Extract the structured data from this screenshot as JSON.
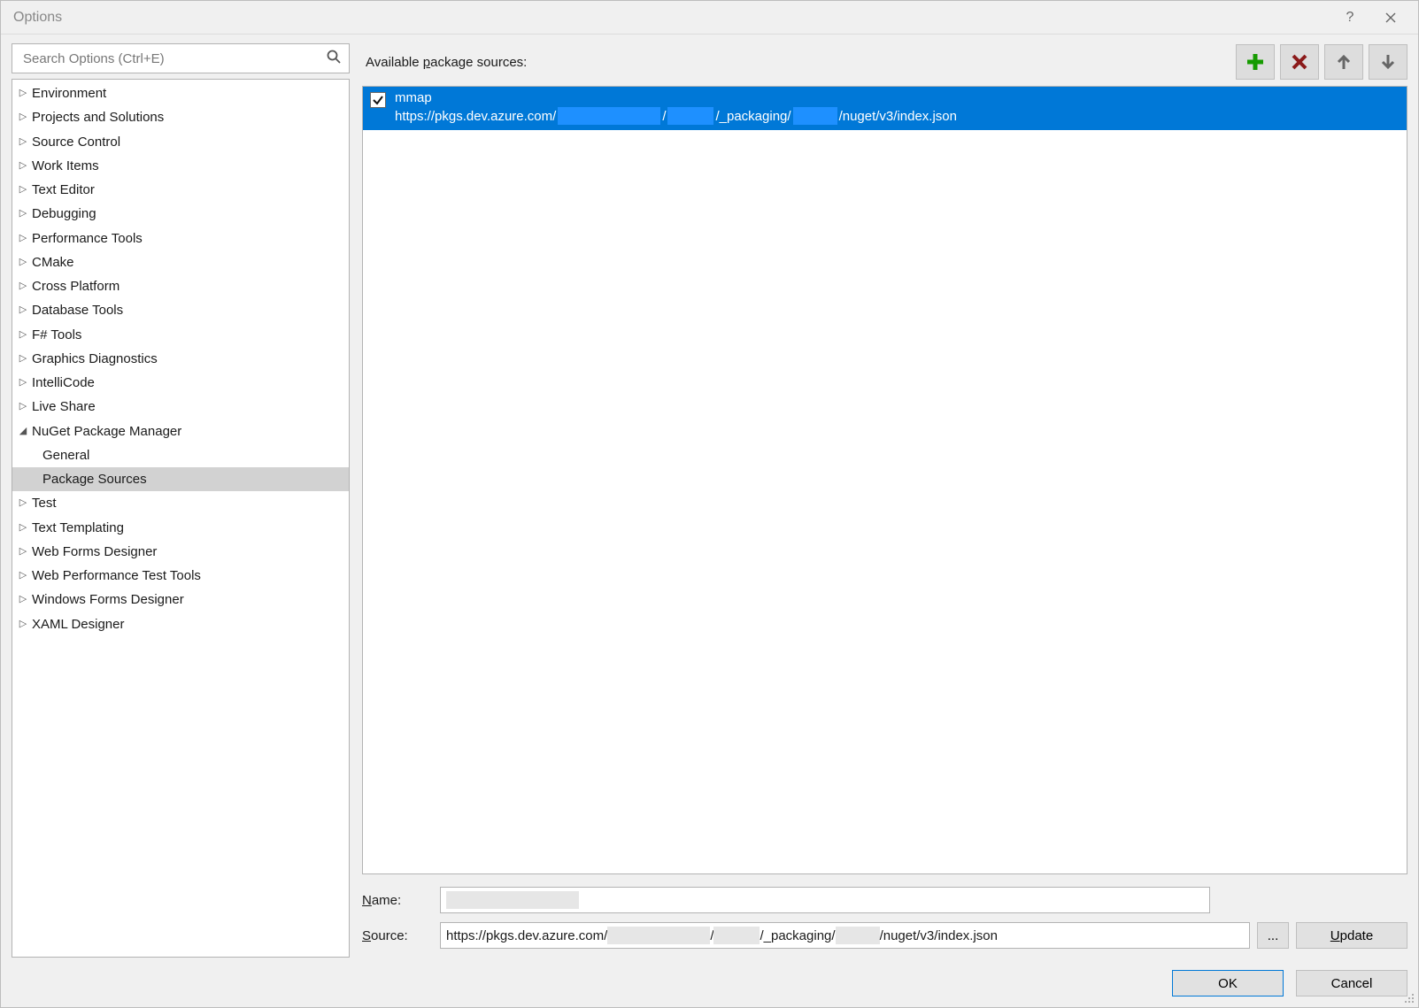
{
  "window": {
    "title": "Options",
    "help_tooltip": "?",
    "close_tooltip": "Close"
  },
  "search": {
    "placeholder": "Search Options (Ctrl+E)"
  },
  "tree": [
    {
      "label": "Environment",
      "level": 0,
      "expanded": false
    },
    {
      "label": "Projects and Solutions",
      "level": 0,
      "expanded": false
    },
    {
      "label": "Source Control",
      "level": 0,
      "expanded": false
    },
    {
      "label": "Work Items",
      "level": 0,
      "expanded": false
    },
    {
      "label": "Text Editor",
      "level": 0,
      "expanded": false
    },
    {
      "label": "Debugging",
      "level": 0,
      "expanded": false
    },
    {
      "label": "Performance Tools",
      "level": 0,
      "expanded": false
    },
    {
      "label": "CMake",
      "level": 0,
      "expanded": false
    },
    {
      "label": "Cross Platform",
      "level": 0,
      "expanded": false
    },
    {
      "label": "Database Tools",
      "level": 0,
      "expanded": false
    },
    {
      "label": "F# Tools",
      "level": 0,
      "expanded": false
    },
    {
      "label": "Graphics Diagnostics",
      "level": 0,
      "expanded": false
    },
    {
      "label": "IntelliCode",
      "level": 0,
      "expanded": false
    },
    {
      "label": "Live Share",
      "level": 0,
      "expanded": false
    },
    {
      "label": "NuGet Package Manager",
      "level": 0,
      "expanded": true
    },
    {
      "label": "General",
      "level": 1,
      "expanded": null
    },
    {
      "label": "Package Sources",
      "level": 1,
      "expanded": null,
      "selected": true
    },
    {
      "label": "Test",
      "level": 0,
      "expanded": false
    },
    {
      "label": "Text Templating",
      "level": 0,
      "expanded": false
    },
    {
      "label": "Web Forms Designer",
      "level": 0,
      "expanded": false
    },
    {
      "label": "Web Performance Test Tools",
      "level": 0,
      "expanded": false
    },
    {
      "label": "Windows Forms Designer",
      "level": 0,
      "expanded": false
    },
    {
      "label": "XAML Designer",
      "level": 0,
      "expanded": false
    }
  ],
  "content": {
    "heading": "Available package sources:",
    "toolbar": {
      "add": "Add",
      "remove": "Remove",
      "up": "Move Up",
      "down": "Move Down"
    },
    "sources": [
      {
        "checked": true,
        "name": "mmap",
        "url_parts": [
          "https://pkgs.dev.azure.com/",
          "/",
          "/_packaging/",
          "/nuget/v3/index.json"
        ]
      }
    ],
    "form": {
      "name_label": "Name:",
      "name_value": "",
      "source_label": "Source:",
      "source_parts": [
        "https://pkgs.dev.azure.com/",
        "/",
        "/_packaging/",
        "/nuget/v3/index.json"
      ],
      "browse_label": "...",
      "update_label": "Update"
    }
  },
  "footer": {
    "ok": "OK",
    "cancel": "Cancel"
  }
}
